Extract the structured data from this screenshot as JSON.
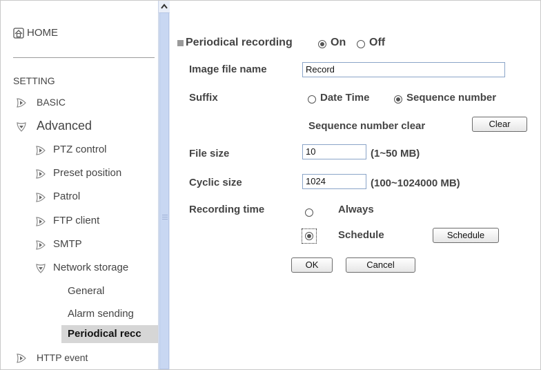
{
  "sidebar": {
    "home_label": "HOME",
    "setting_label": "SETTING",
    "basic_label": "BASIC",
    "advanced_label": "Advanced",
    "items": [
      {
        "label": "PTZ control"
      },
      {
        "label": "Preset position"
      },
      {
        "label": "Patrol"
      },
      {
        "label": "FTP client"
      },
      {
        "label": "SMTP"
      },
      {
        "label": "Network storage"
      }
    ],
    "subitems": [
      {
        "label": "General"
      },
      {
        "label": "Alarm sending"
      },
      {
        "label": "Periodical recc"
      }
    ],
    "http_event_label": "HTTP event"
  },
  "form": {
    "title": "Periodical recording",
    "on_label": "On",
    "off_label": "Off",
    "periodical_recording": "On",
    "image_file_name_label": "Image file name",
    "image_file_name": "Record",
    "suffix_label": "Suffix",
    "suffix_date_time": "Date Time",
    "suffix_sequence_number": "Sequence number",
    "suffix_selected": "Sequence number",
    "seq_clear_label": "Sequence number clear",
    "clear_button": "Clear",
    "file_size_label": "File size",
    "file_size": "10",
    "file_size_range": "(1~50 MB)",
    "cyclic_size_label": "Cyclic size",
    "cyclic_size": "1024",
    "cyclic_size_range": "(100~1024000 MB)",
    "recording_time_label": "Recording time",
    "always_label": "Always",
    "schedule_label": "Schedule",
    "recording_time_selected": "Schedule",
    "schedule_button": "Schedule",
    "ok_button": "OK",
    "cancel_button": "Cancel"
  }
}
